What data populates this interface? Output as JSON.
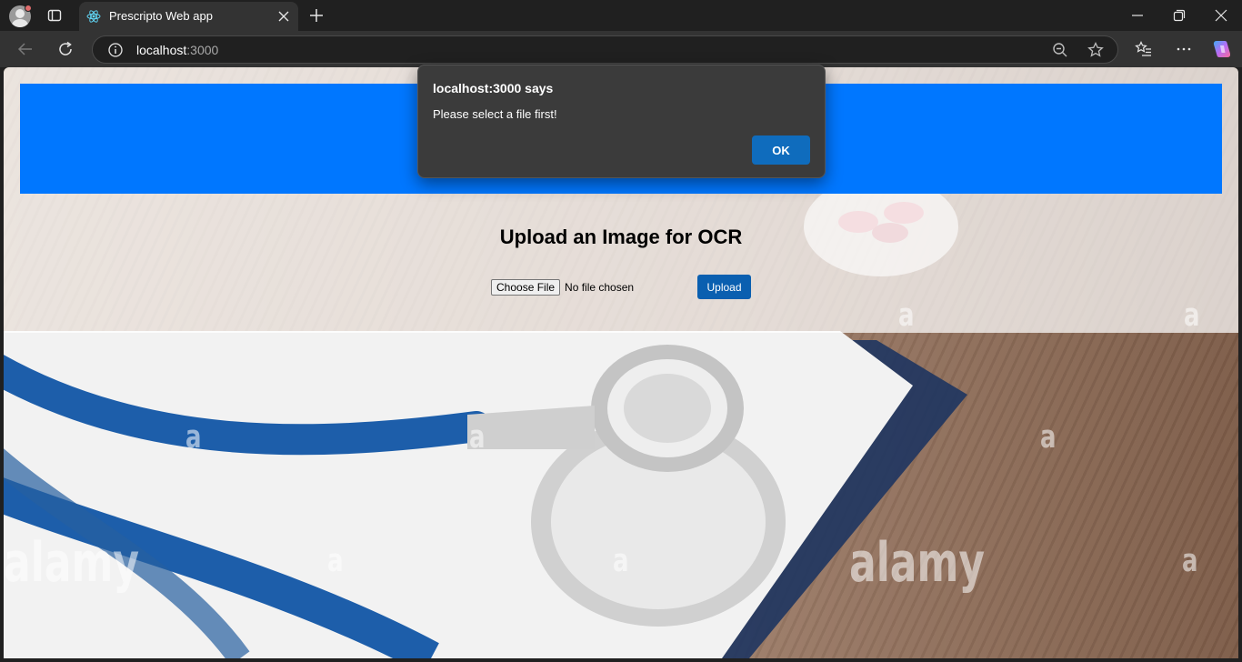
{
  "browser": {
    "tab_title": "Prescripto Web app",
    "url_host": "localhost",
    "url_port": ":3000"
  },
  "page": {
    "heading": "Upload an Image for OCR",
    "choose_file_label": "Choose File",
    "file_status": "No file chosen",
    "upload_label": "Upload",
    "header_color": "#0077ff"
  },
  "background": {
    "watermark_text": "alamy",
    "watermark_small": "a"
  },
  "dialog": {
    "title": "localhost:3000 says",
    "message": "Please select a file first!",
    "ok_label": "OK"
  },
  "icons": {
    "profile": "profile-avatar-icon",
    "tab_actions": "tab-actions-icon",
    "favicon": "react-logo-icon",
    "close": "close-icon",
    "new_tab": "plus-icon",
    "back": "back-arrow-icon",
    "refresh": "refresh-icon",
    "info": "info-icon",
    "zoom": "zoom-out-icon",
    "favorite": "star-icon",
    "favorites": "favorites-icon",
    "more": "more-icon",
    "copilot": "copilot-icon"
  }
}
